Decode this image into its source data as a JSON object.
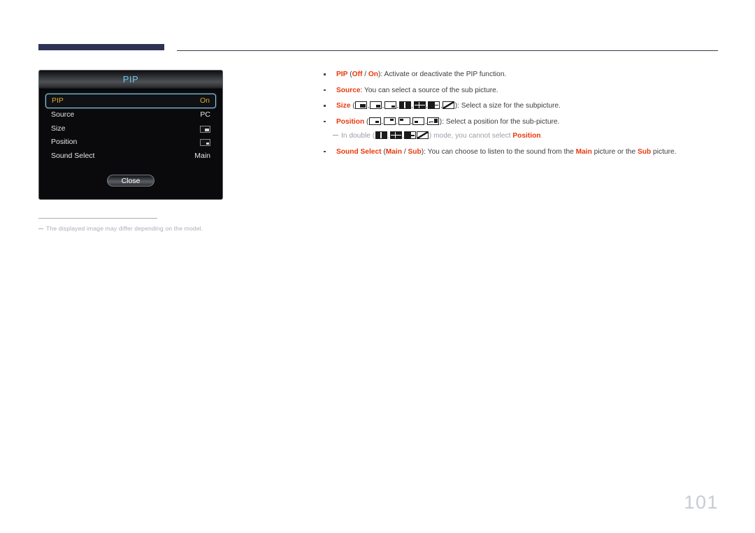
{
  "page": {
    "number": "101"
  },
  "osd": {
    "title": "PIP",
    "rows": [
      {
        "label": "PIP",
        "value": "On",
        "value_type": "text",
        "selected": true
      },
      {
        "label": "Source",
        "value": "PC",
        "value_type": "text",
        "selected": false
      },
      {
        "label": "Size",
        "value": "size-pictogram",
        "value_type": "icon",
        "selected": false
      },
      {
        "label": "Position",
        "value": "position-pictogram",
        "value_type": "icon",
        "selected": false
      },
      {
        "label": "Sound Select",
        "value": "Main",
        "value_type": "text",
        "selected": false
      }
    ],
    "close_label": "Close",
    "colors": {
      "title_text": "#6fc6e8",
      "selected_text": "#d9ad2e",
      "selected_border": "#8fd3f0",
      "background": "#0a0a0c"
    }
  },
  "note": {
    "text": "The displayed image may differ depending on the model."
  },
  "content": {
    "accent_color": "#e8380d",
    "items": [
      {
        "id": "pip",
        "parts": [
          {
            "t": "PIP",
            "kw": true
          },
          {
            "t": " ("
          },
          {
            "t": "Off",
            "kw": true
          },
          {
            "t": " / "
          },
          {
            "t": "On",
            "kw": true
          },
          {
            "t": "): Activate or deactivate the PIP function."
          }
        ]
      },
      {
        "id": "source",
        "parts": [
          {
            "t": "Source",
            "kw": true
          },
          {
            "t": ": You can select a source of the sub picture."
          }
        ]
      },
      {
        "id": "size",
        "parts": [
          {
            "t": "Size",
            "kw": true
          },
          {
            "t": " ("
          },
          {
            "icons": [
              "pip-size-large-icon",
              "pip-size-medium-icon",
              "pip-size-small-icon",
              "pip-double-vertical-icon",
              "pip-double-quad-icon",
              "pip-double-wide-icon",
              "pip-double-diagonal-icon"
            ]
          },
          {
            "t": "): Select a size for the subpicture."
          }
        ]
      },
      {
        "id": "position",
        "parts": [
          {
            "t": "Position",
            "kw": true
          },
          {
            "t": " ("
          },
          {
            "icons": [
              "pip-pos-bottom-right-icon",
              "pip-pos-top-right-icon",
              "pip-pos-top-left-icon",
              "pip-pos-bottom-left-icon",
              "pip-pos-custom-icon"
            ]
          },
          {
            "t": "): Select a position for the sub-picture."
          }
        ]
      },
      {
        "id": "sound-select",
        "parts": [
          {
            "t": "Sound Select",
            "kw": true
          },
          {
            "t": " ("
          },
          {
            "t": "Main",
            "kw": true
          },
          {
            "t": " / "
          },
          {
            "t": "Sub",
            "kw": true
          },
          {
            "t": "): You can choose to listen to the sound from the "
          },
          {
            "t": "Main",
            "kw": true
          },
          {
            "t": " picture or the "
          },
          {
            "t": "Sub",
            "kw": true
          },
          {
            "t": " picture."
          }
        ]
      }
    ],
    "sub_note": {
      "prefix": "In double (",
      "icons": [
        "pip-double-vertical-icon",
        "pip-double-quad-icon",
        "pip-double-wide-icon",
        "pip-double-diagonal-icon"
      ],
      "middle": ") mode, you cannot select ",
      "keyword": "Position",
      "suffix": "."
    }
  }
}
